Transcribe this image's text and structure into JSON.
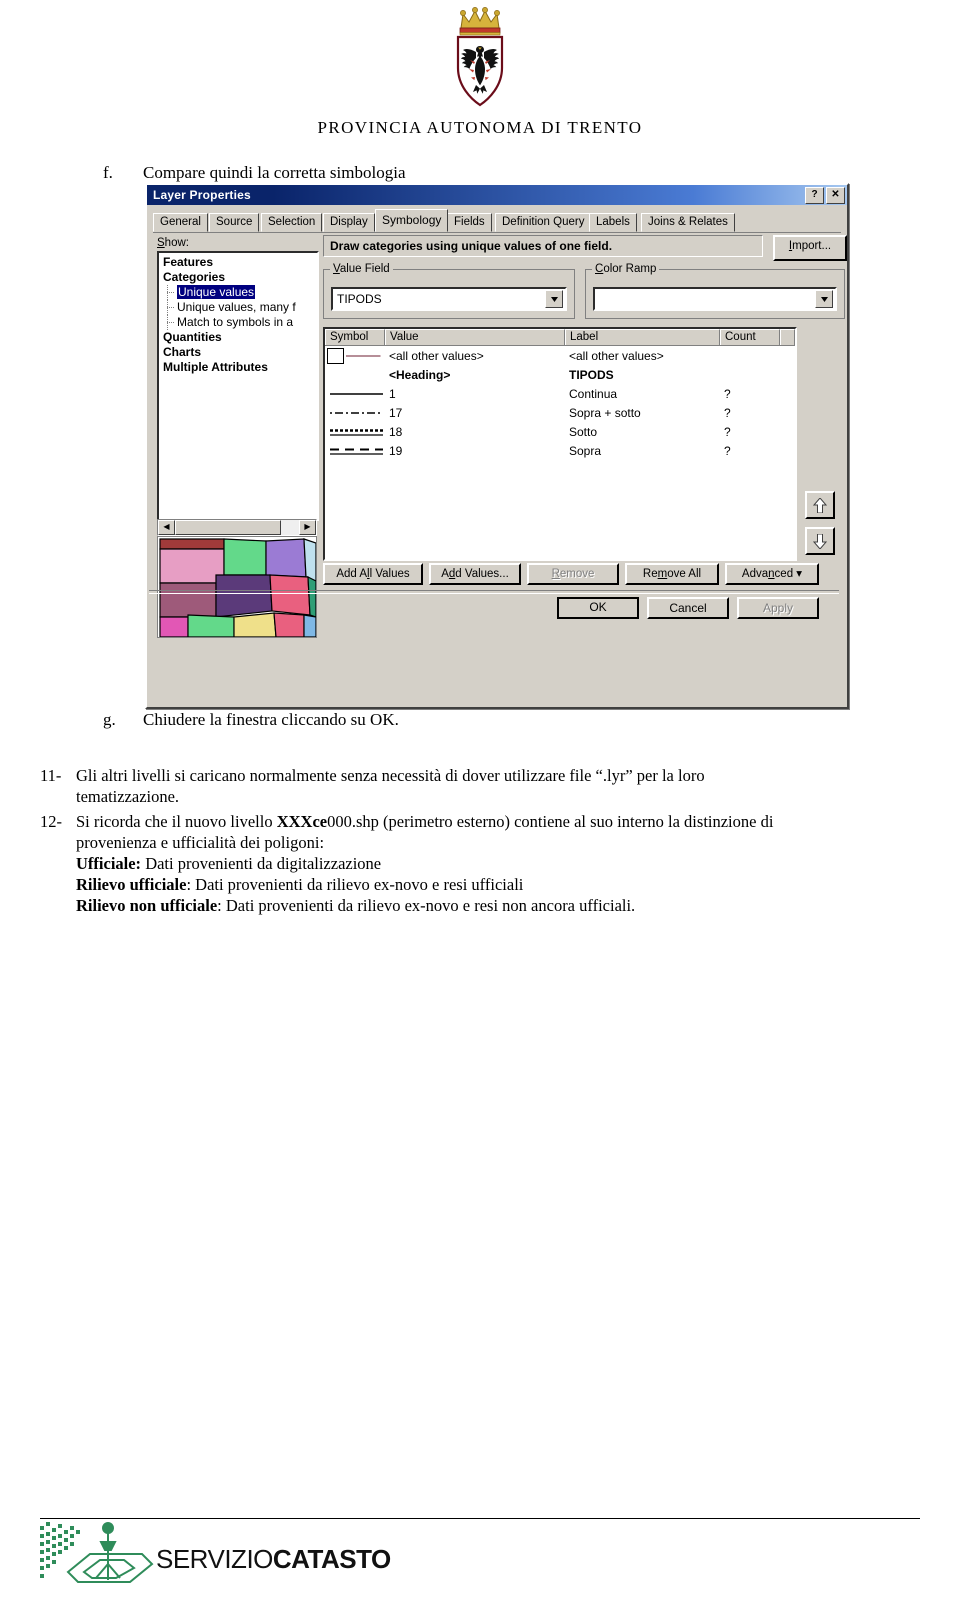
{
  "header": {
    "crest_alt": "provincia-autonoma-di-trento-coat-of-arms",
    "title": "PROVINCIA  AUTONOMA  DI  TRENTO"
  },
  "steps": {
    "f_marker": "f.",
    "f_text": "Compare quindi la corretta simbologia",
    "g_marker": "g.",
    "g_text": "Chiudere la finestra cliccando su OK."
  },
  "paragraphs": {
    "p11_num": "11-",
    "p11_line1": "Gli altri livelli si caricano normalmente senza necessità di dover utilizzare file “.lyr” per la loro",
    "p11_line2": "tematizzazione.",
    "p12_num": "12-",
    "p12_a": "Si ricorda che il  nuovo livello ",
    "p12_b_bold1": "XXX",
    "p12_b_bold2": "ce",
    "p12_b_rest": "000",
    "p12_c": ".shp (perimetro esterno) contiene al suo interno la distinzione di",
    "p12_line2": "provenienza e ufficialità dei poligoni:",
    "p12_l1_label": "Ufficiale:",
    "p12_l1_text": " Dati provenienti da digitalizzazione",
    "p12_l2_label": "Rilievo ufficiale",
    "p12_l2_text": ": Dati provenienti da rilievo ex-novo e resi ufficiali",
    "p12_l3_label": "Rilievo non ufficiale",
    "p12_l3_text": ": Dati provenienti da rilievo ex-novo e resi non ancora ufficiali."
  },
  "dialog": {
    "title": "Layer Properties",
    "help_button": "?",
    "close_button": "✕",
    "tabs": [
      {
        "label": "General",
        "active": false
      },
      {
        "label": "Source",
        "active": false
      },
      {
        "label": "Selection",
        "active": false
      },
      {
        "label": "Display",
        "active": false
      },
      {
        "label": "Symbology",
        "active": true
      },
      {
        "label": "Fields",
        "active": false
      },
      {
        "label": "Definition Query",
        "active": false
      },
      {
        "label": "Labels",
        "active": false
      },
      {
        "label": "Joins & Relates",
        "active": false
      }
    ],
    "show_label": "Show:",
    "tree": [
      {
        "label": "Features",
        "type": "node",
        "selected": false
      },
      {
        "label": "Categories",
        "type": "node",
        "selected": false
      },
      {
        "label": "Unique values",
        "type": "child",
        "selected": true
      },
      {
        "label": "Unique values, many f",
        "type": "child",
        "selected": false
      },
      {
        "label": "Match to symbols in a",
        "type": "child",
        "selected": false
      },
      {
        "label": "Quantities",
        "type": "node",
        "selected": false
      },
      {
        "label": "Charts",
        "type": "node",
        "selected": false
      },
      {
        "label": "Multiple Attributes",
        "type": "node",
        "selected": false
      }
    ],
    "description": "Draw categories using unique values of one field.",
    "import_label": "Import...",
    "value_field_group": "Value Field",
    "value_field_value": "TIPODS",
    "color_ramp_group": "Color Ramp",
    "color_ramp_value": "",
    "table": {
      "columns": [
        "Symbol",
        "Value",
        "Label",
        "Count"
      ],
      "rows": [
        {
          "symbol": "polygon-swatch-line",
          "value": "<all other values>",
          "label": "<all other values>",
          "count": "",
          "bold": false
        },
        {
          "symbol": "none",
          "value": "<Heading>",
          "label": "TIPODS",
          "count": "",
          "bold": true
        },
        {
          "symbol": "line-solid",
          "value": "1",
          "label": "Continua",
          "count": "?",
          "bold": false
        },
        {
          "symbol": "line-dashdot",
          "value": "17",
          "label": "Sopra + sotto",
          "count": "?",
          "bold": false
        },
        {
          "symbol": "line-dotted",
          "value": "18",
          "label": "Sotto",
          "count": "?",
          "bold": false
        },
        {
          "symbol": "line-dashed",
          "value": "19",
          "label": "Sopra",
          "count": "?",
          "bold": false
        }
      ]
    },
    "move_up_icon": "arrow-up",
    "move_down_icon": "arrow-down",
    "buttons": [
      {
        "label": "Add All Values",
        "disabled": false
      },
      {
        "label": "Add Values...",
        "disabled": false
      },
      {
        "label": "Remove",
        "disabled": true
      },
      {
        "label": "Remove All",
        "disabled": false
      },
      {
        "label": "Advanced",
        "disabled": false,
        "has_arrow": true
      }
    ],
    "footer_buttons": [
      {
        "label": "OK",
        "disabled": false,
        "default": true
      },
      {
        "label": "Cancel",
        "disabled": false,
        "default": false
      },
      {
        "label": "Apply",
        "disabled": true,
        "default": false
      }
    ]
  },
  "footer": {
    "logo_text_light": "SERVIZIO",
    "logo_text_bold": "CATASTO",
    "logo_color": "#1f7a4d"
  }
}
